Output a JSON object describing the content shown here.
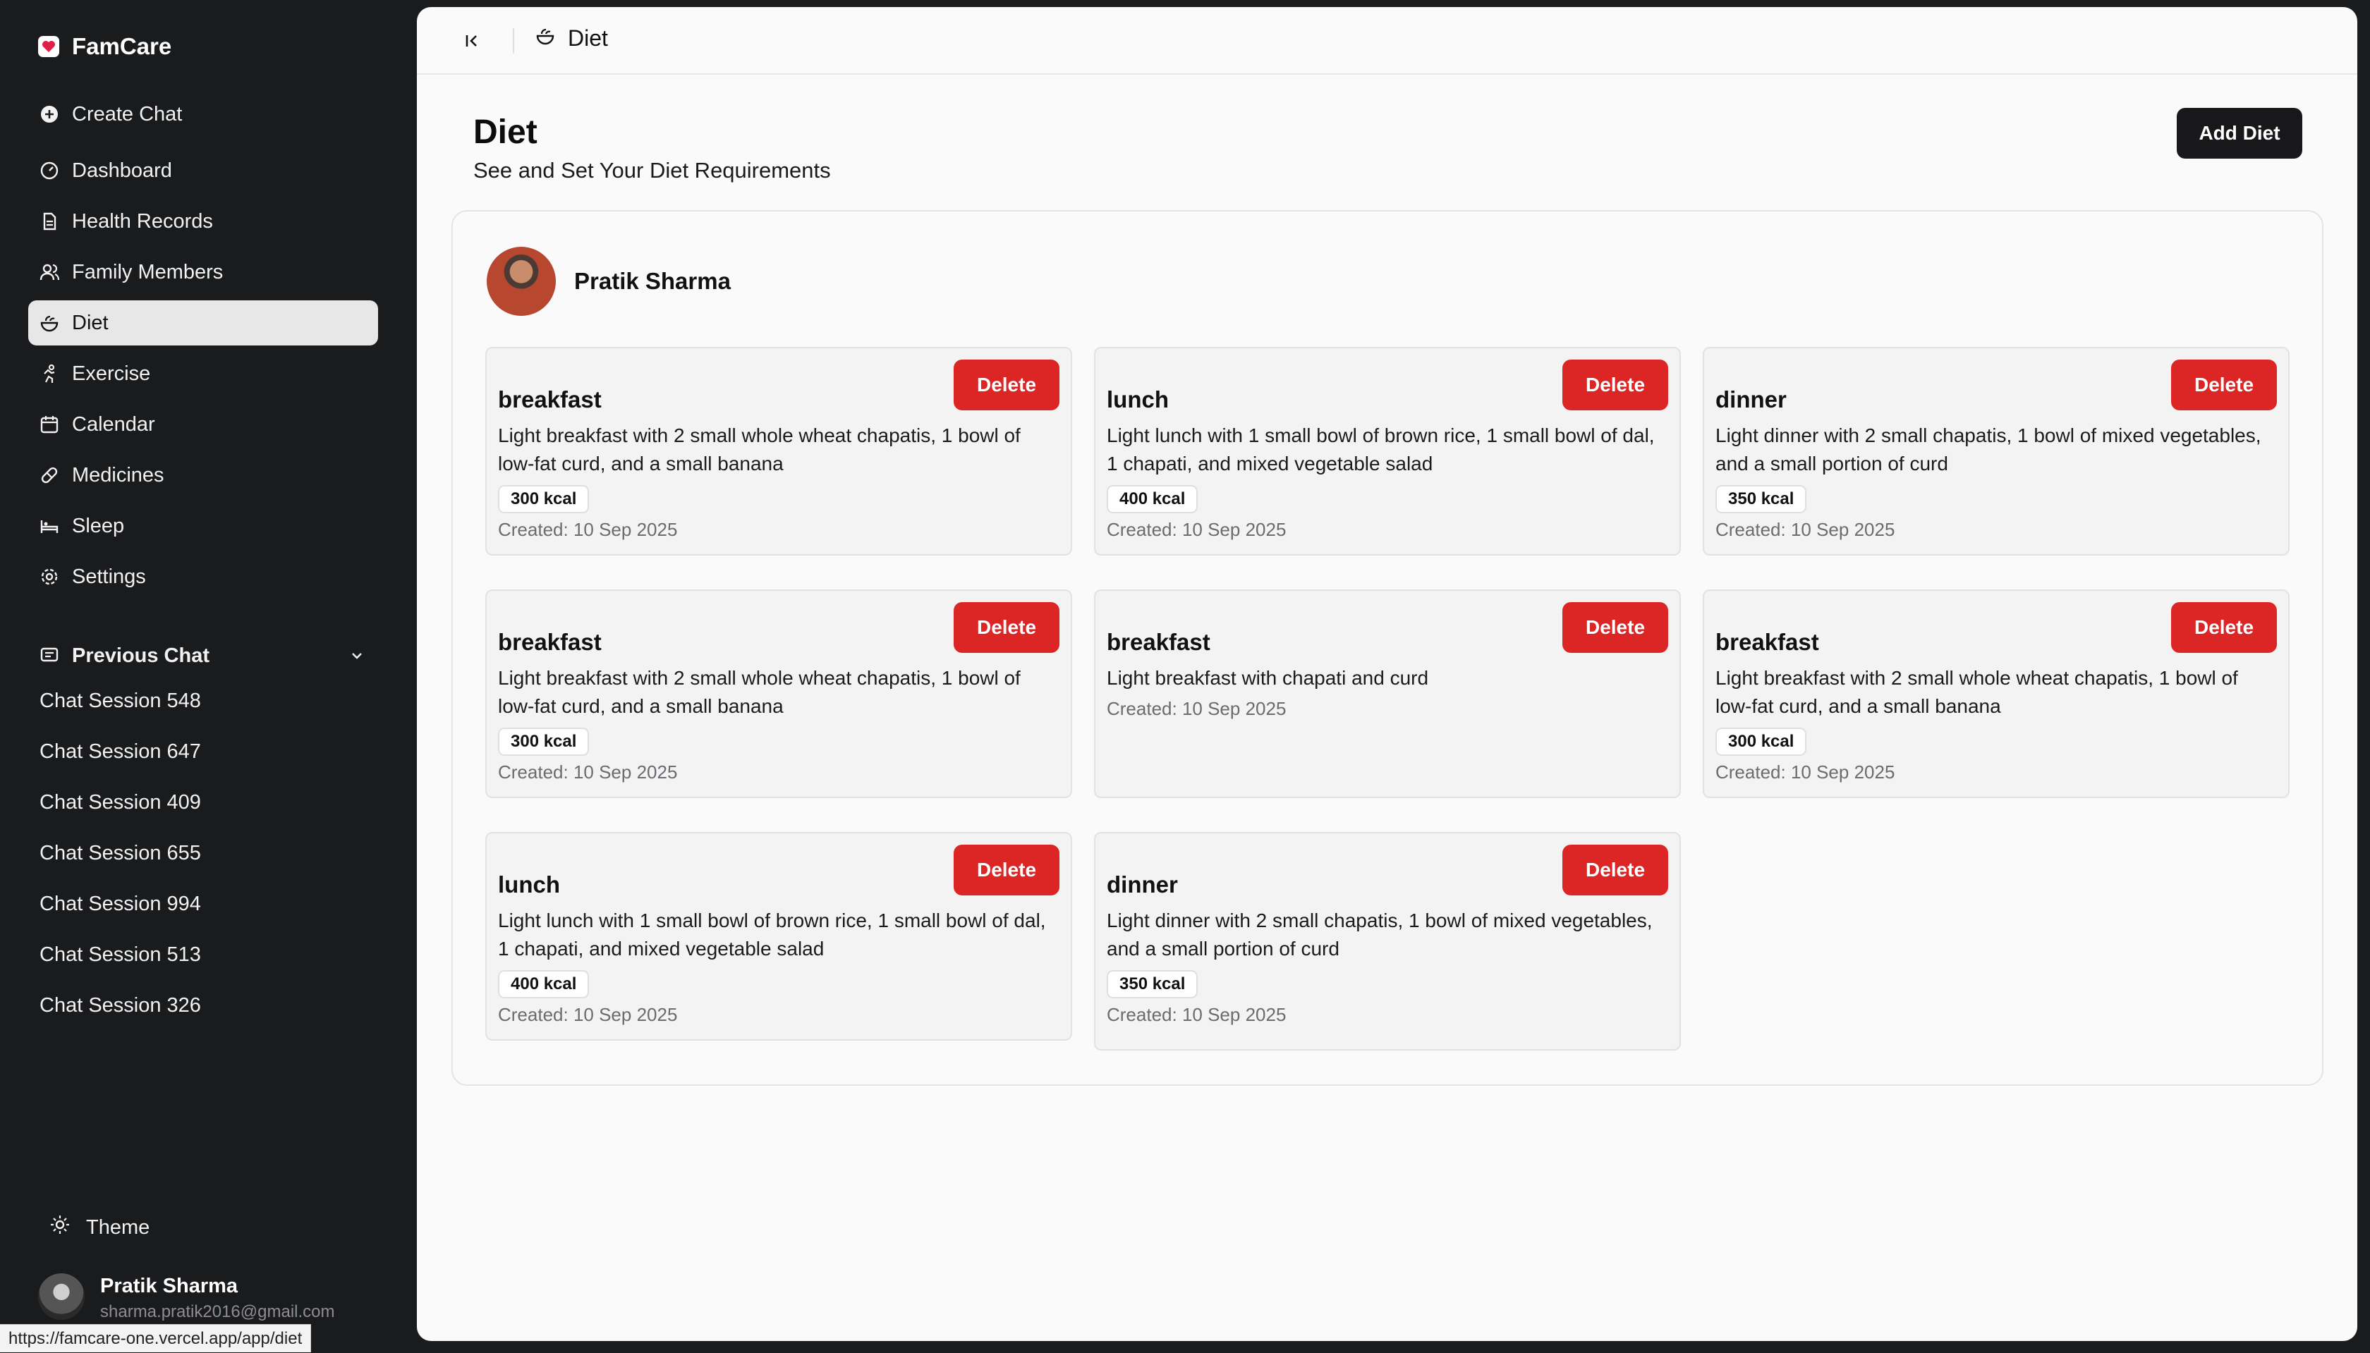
{
  "app": {
    "name": "FamCare"
  },
  "sidebar": {
    "create_chat": "Create Chat",
    "items": [
      {
        "label": "Dashboard"
      },
      {
        "label": "Health Records"
      },
      {
        "label": "Family Members"
      },
      {
        "label": "Diet"
      },
      {
        "label": "Exercise"
      },
      {
        "label": "Calendar"
      },
      {
        "label": "Medicines"
      },
      {
        "label": "Sleep"
      },
      {
        "label": "Settings"
      }
    ],
    "previous_chat_label": "Previous Chat",
    "chats": [
      "Chat Session 548",
      "Chat Session 647",
      "Chat Session 409",
      "Chat Session 655",
      "Chat Session 994",
      "Chat Session 513",
      "Chat Session 326"
    ],
    "theme_label": "Theme",
    "user": {
      "name": "Pratik Sharma",
      "email": "sharma.pratik2016@gmail.com"
    }
  },
  "status_bar": {
    "url": "https://famcare-one.vercel.app/app/diet"
  },
  "header": {
    "breadcrumb": "Diet"
  },
  "page": {
    "title": "Diet",
    "subtitle": "See and Set Your Diet Requirements",
    "add_button": "Add Diet"
  },
  "member": {
    "name": "Pratik Sharma"
  },
  "delete_label": "Delete",
  "diets": [
    {
      "meal": "breakfast",
      "description": "Light breakfast with 2 small whole wheat chapatis, 1 bowl of low-fat curd, and a small banana",
      "kcal": "300 kcal",
      "created": "Created: 10 Sep 2025"
    },
    {
      "meal": "lunch",
      "description": "Light lunch with 1 small bowl of brown rice, 1 small bowl of dal, 1 chapati, and mixed vegetable salad",
      "kcal": "400 kcal",
      "created": "Created: 10 Sep 2025"
    },
    {
      "meal": "dinner",
      "description": "Light dinner with 2 small chapatis, 1 bowl of mixed vegetables, and a small portion of curd",
      "kcal": "350 kcal",
      "created": "Created: 10 Sep 2025"
    },
    {
      "meal": "breakfast",
      "description": "Light breakfast with 2 small whole wheat chapatis, 1 bowl of low-fat curd, and a small banana",
      "kcal": "300 kcal",
      "created": "Created: 10 Sep 2025"
    },
    {
      "meal": "breakfast",
      "description": "Light breakfast with chapati and curd",
      "kcal": "",
      "created": "Created: 10 Sep 2025"
    },
    {
      "meal": "breakfast",
      "description": "Light breakfast with 2 small whole wheat chapatis, 1 bowl of low-fat curd, and a small banana",
      "kcal": "300 kcal",
      "created": "Created: 10 Sep 2025"
    },
    {
      "meal": "lunch",
      "description": "Light lunch with 1 small bowl of brown rice, 1 small bowl of dal, 1 chapati, and mixed vegetable salad",
      "kcal": "400 kcal",
      "created": "Created: 10 Sep 2025"
    },
    {
      "meal": "dinner",
      "description": "Light dinner with 2 small chapatis, 1 bowl of mixed vegetables, and a small portion of curd",
      "kcal": "350 kcal",
      "created": "Created: 10 Sep 2025"
    }
  ],
  "colors": {
    "delete": "#dc2626",
    "primary": "#18181b",
    "sidebar": "#1a1b1d",
    "brand_heart": "#e11d48"
  }
}
